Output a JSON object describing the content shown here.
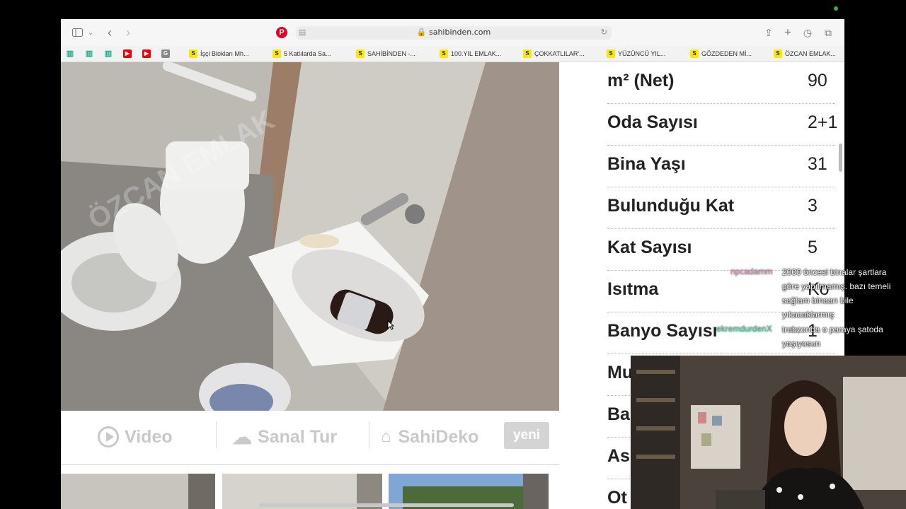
{
  "browser": {
    "url": "sahibinden.com",
    "favorites": [
      {
        "icon": "chart-icon",
        "label": ""
      },
      {
        "icon": "chart-icon",
        "label": ""
      },
      {
        "icon": "chart-icon",
        "label": ""
      },
      {
        "icon": "youtube-icon",
        "label": ""
      },
      {
        "icon": "youtube-icon",
        "label": ""
      },
      {
        "icon": "g-icon",
        "label": ""
      },
      {
        "icon": "sahibinden-icon",
        "label": "İşçi Blokları Mh..."
      },
      {
        "icon": "sahibinden-icon",
        "label": "5 Katlılarda Sa..."
      },
      {
        "icon": "sahibinden-icon",
        "label": "SAHİBİNDEN -..."
      },
      {
        "icon": "sahibinden-icon",
        "label": "100.YIL EMLAK..."
      },
      {
        "icon": "sahibinden-icon",
        "label": "ÇOKKATLILAR'..."
      },
      {
        "icon": "sahibinden-icon",
        "label": "YÜZÜNCÜ YIL..."
      },
      {
        "icon": "sahibinden-icon",
        "label": "GÖZDEDEN Mİ..."
      },
      {
        "icon": "sahibinden-icon",
        "label": "ÖZCAN EMLAK..."
      }
    ]
  },
  "listing": {
    "watermark": "ÖZCAN EMLAK",
    "media": {
      "video": "Video",
      "virtual_tour": "Sanal Tur",
      "sahideko": "SahiDeko",
      "new_badge": "yeni"
    },
    "details": [
      {
        "label": "m² (Net)",
        "value": "90"
      },
      {
        "label": "Oda Sayısı",
        "value": "2+1"
      },
      {
        "label": "Bina Yaşı",
        "value": "31"
      },
      {
        "label": "Bulunduğu Kat",
        "value": "3"
      },
      {
        "label": "Kat Sayısı",
        "value": "5"
      },
      {
        "label": "Isıtma",
        "value": "Ko"
      },
      {
        "label": "Banyo Sayısı",
        "value": "1"
      },
      {
        "label": "Mu",
        "value": ""
      },
      {
        "label": "Ba",
        "value": ""
      },
      {
        "label": "As",
        "value": ""
      },
      {
        "label": "Ot",
        "value": ""
      }
    ]
  },
  "chat": [
    {
      "user": "npcadamm",
      "text": "2000 öncesi binalar şartlara göre yapılmamış. bazı temeli sağlam binaarı bile yıkacaklarmış",
      "color": "#e29ac0"
    },
    {
      "user": "ekremdurdenX",
      "text": "trabzonda o paraya şatoda yaşıyosun",
      "color": "#4fe0a6"
    }
  ]
}
